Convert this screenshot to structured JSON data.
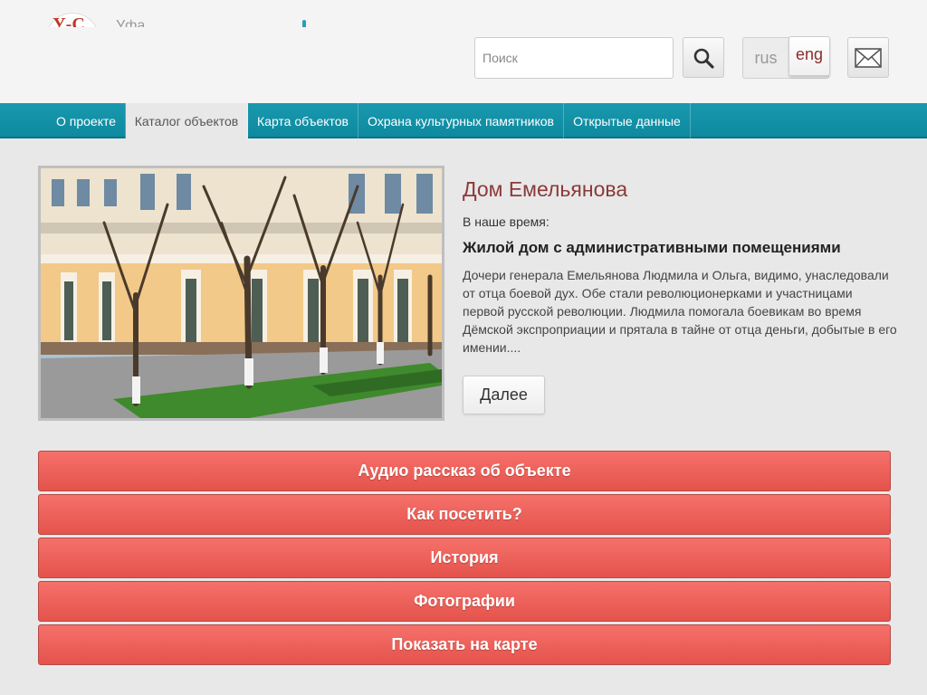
{
  "header": {
    "logo_mark": "У-С",
    "logo_text": "Уфа",
    "search_placeholder": "Поиск",
    "lang_rus": "rus",
    "lang_eng": "eng"
  },
  "nav": {
    "items": [
      {
        "label": "О проекте",
        "active": false
      },
      {
        "label": "Каталог объектов",
        "active": true
      },
      {
        "label": "Карта объектов",
        "active": false
      },
      {
        "label": "Охрана культурных памятников",
        "active": false
      },
      {
        "label": "Открытые данные",
        "active": false
      }
    ]
  },
  "object": {
    "title": "Дом Емельянова",
    "now_label": "В наше время:",
    "now_value": "Жилой дом с административными помещениями",
    "description": "Дочери генерала Емельянова Людмила и Ольга, видимо, унаследовали от отца боевой дух. Обе стали революционерками и участницами первой русской революции. Людмила помогала боевикам во время Дёмской экспроприации и прятала в тайне от отца деньги, добытые в его имении....",
    "more_label": "Далее"
  },
  "actions": [
    {
      "label": "Аудио рассказ об объекте"
    },
    {
      "label": "Как посетить?"
    },
    {
      "label": "История"
    },
    {
      "label": "Фотографии"
    },
    {
      "label": "Показать на карте"
    }
  ],
  "colors": {
    "nav_bg": "#1998ae",
    "action_bg": "#ec625b",
    "title": "#8b3a3a",
    "lang_active": "#8b2c2c"
  }
}
